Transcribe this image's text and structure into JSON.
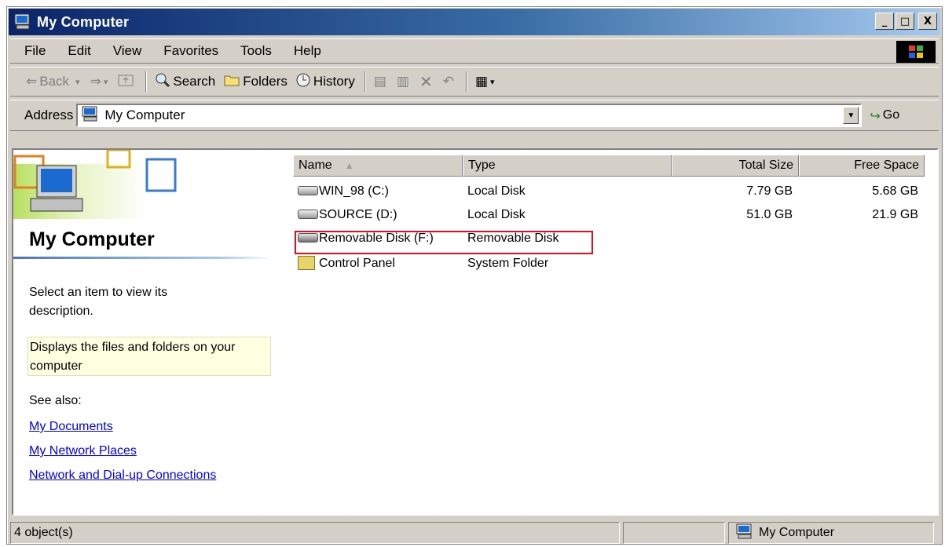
{
  "window": {
    "title": "My Computer",
    "controls": {
      "minimize": "_",
      "maximize": "□",
      "close": "X"
    }
  },
  "menubar": {
    "items": [
      "File",
      "Edit",
      "View",
      "Favorites",
      "Tools",
      "Help"
    ]
  },
  "toolbar": {
    "back_label": "Back",
    "search_label": "Search",
    "folders_label": "Folders",
    "history_label": "History"
  },
  "address": {
    "label": "Address",
    "value": "My Computer",
    "go_label": "Go"
  },
  "leftpane": {
    "title": "My Computer",
    "description": "Select an item to view its description.",
    "info": "Displays the files and folders on your computer",
    "see_also": "See also:",
    "links": [
      "My Documents",
      "My Network Places",
      "Network and Dial-up Connections"
    ]
  },
  "list": {
    "columns": [
      "Name",
      "Type",
      "Total Size",
      "Free Space"
    ],
    "rows": [
      {
        "name": "WIN_98 (C:)",
        "type": "Local Disk",
        "total": "7.79 GB",
        "free": "5.68 GB",
        "icon": "hard-drive-icon"
      },
      {
        "name": "SOURCE (D:)",
        "type": "Local Disk",
        "total": "51.0 GB",
        "free": "21.9 GB",
        "icon": "hard-drive-icon"
      },
      {
        "name": "Removable Disk (F:)",
        "type": "Removable Disk",
        "total": "",
        "free": "",
        "icon": "removable-drive-icon",
        "highlighted": true
      },
      {
        "name": "Control Panel",
        "type": "System Folder",
        "total": "",
        "free": "",
        "icon": "control-panel-icon"
      }
    ],
    "highlight_color": "#e0101a"
  },
  "statusbar": {
    "count": "4 object(s)",
    "zone": "My Computer"
  },
  "colors": {
    "titlebar_start": "#0a246a",
    "titlebar_end": "#a6caf0",
    "face": "#d4d0c8",
    "link": "#0000ff",
    "info_bg": "#ffffe1"
  }
}
